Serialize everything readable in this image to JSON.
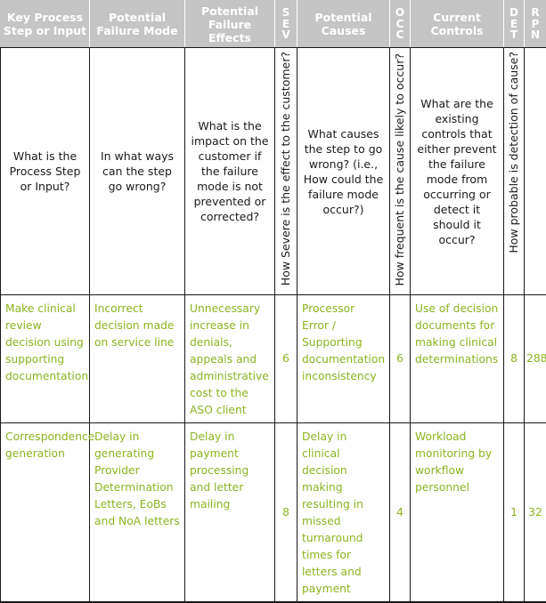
{
  "table": {
    "headers": [
      {
        "id": "key-process-step",
        "label": "Key Process Step or Input",
        "orientation": "horizontal"
      },
      {
        "id": "potential-failure-mode",
        "label": "Potential Failure Mode",
        "orientation": "horizontal"
      },
      {
        "id": "potential-failure-effects",
        "label": "Potential Failure Effects",
        "orientation": "horizontal"
      },
      {
        "id": "sev",
        "label": "SEV",
        "l1": "S",
        "l2": "E",
        "l3": "V",
        "orientation": "stacked"
      },
      {
        "id": "potential-causes",
        "label": "Potential Causes",
        "orientation": "horizontal"
      },
      {
        "id": "occ",
        "label": "OCC",
        "l1": "O",
        "l2": "C",
        "l3": "C",
        "orientation": "stacked"
      },
      {
        "id": "current-controls",
        "label": "Current Controls",
        "orientation": "horizontal"
      },
      {
        "id": "det",
        "label": "DET",
        "l1": "D",
        "l2": "E",
        "l3": "T",
        "orientation": "stacked"
      },
      {
        "id": "rpn",
        "label": "RPN",
        "l1": "R",
        "l2": "P",
        "l3": "N",
        "orientation": "stacked"
      }
    ],
    "questions": {
      "key_process_step": "What is the Process Step or Input?",
      "potential_failure_mode": "In what ways can the step go wrong?",
      "potential_failure_effects": "What is the impact on the customer if the failure mode is not prevented or corrected?",
      "sev": "How Severe is the effect to the customer?",
      "potential_causes": "What causes the step to go wrong? (i.e., How could the failure mode occur?)",
      "occ": "How frequent is the cause likely to occur?",
      "current_controls": "What are the existing controls that either prevent the failure mode from occurring or detect it should it occur?",
      "det": "How probable is detection of cause?",
      "rpn": ""
    },
    "rows": [
      {
        "key_process_step": "Make clinical review decision using supporting documentation",
        "potential_failure_mode": "Incorrect decision made on service line",
        "potential_failure_effects": "Unnecessary increase in denials, appeals and administrative cost to the ASO client",
        "sev": "6",
        "potential_causes": "Processor Error / Supporting documentation inconsistency",
        "occ": "6",
        "current_controls": "Use of decision documents for making clinical determinations",
        "det": "8",
        "rpn": "288"
      },
      {
        "key_process_step": "Correspondence generation",
        "potential_failure_mode": "Delay in generating Provider Determination Letters, EoBs and NoA letters",
        "potential_failure_effects": "Delay in payment processing and letter mailing",
        "sev": "8",
        "potential_causes": "Delay in clinical decision making resulting in missed turnaround times for letters and payment",
        "occ": "4",
        "current_controls": "Workload monitoring by workflow personnel",
        "det": "1",
        "rpn": "32"
      }
    ]
  },
  "colors": {
    "header_background": "#c5c5c5",
    "header_text": "#ffffff",
    "data_text": "#8cb420",
    "question_text": "#1a1a1a",
    "border": "#1a1a1a"
  }
}
